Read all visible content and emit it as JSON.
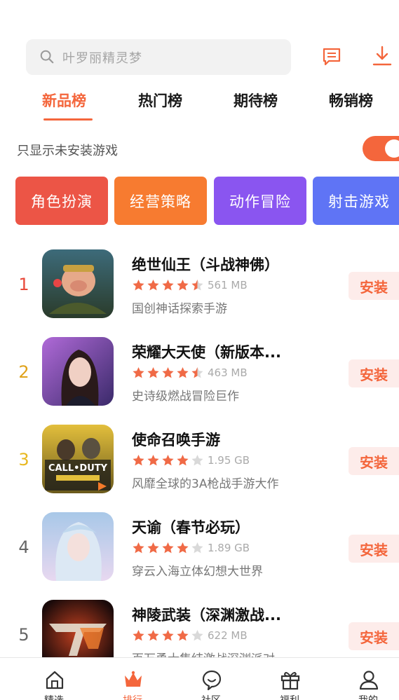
{
  "search": {
    "placeholder": "叶罗丽精灵梦"
  },
  "header_icons": [
    "message-icon",
    "download-icon"
  ],
  "tabs": [
    {
      "label": "新品榜",
      "active": true
    },
    {
      "label": "热门榜",
      "active": false
    },
    {
      "label": "期待榜",
      "active": false
    },
    {
      "label": "畅销榜",
      "active": false
    }
  ],
  "filter": {
    "label": "只显示未安装游戏",
    "toggle_on": true
  },
  "categories": [
    {
      "label": "角色扮演",
      "color": "#ec5546"
    },
    {
      "label": "经营策略",
      "color": "#f77b30"
    },
    {
      "label": "动作冒险",
      "color": "#8a55f0"
    },
    {
      "label": "射击游戏",
      "color": "#5f74f5"
    }
  ],
  "apps": [
    {
      "rank": "1",
      "rank_color": "#e8493a",
      "name": "绝世仙王（斗战神佛）",
      "rating": 4.5,
      "size": "561 MB",
      "desc": "国创神话探索手游",
      "install": "安装"
    },
    {
      "rank": "2",
      "rank_color": "#e0a21a",
      "name": "荣耀大天使（新版本...",
      "rating": 4.5,
      "size": "463 MB",
      "desc": "史诗级燃战冒险巨作",
      "install": "安装"
    },
    {
      "rank": "3",
      "rank_color": "#e8b820",
      "name": "使命召唤手游",
      "rating": 4,
      "size": "1.95 GB",
      "desc": "风靡全球的3A枪战手游大作",
      "install": "安装"
    },
    {
      "rank": "4",
      "rank_color": "#666666",
      "name": "天谕（春节必玩）",
      "rating": 4,
      "size": "1.89 GB",
      "desc": "穿云入海立体幻想大世界",
      "install": "安装"
    },
    {
      "rank": "5",
      "rank_color": "#666666",
      "name": "神陵武装（深渊激战...",
      "rating": 4,
      "size": "622 MB",
      "desc": "百万勇士集结激战深渊派对",
      "install": "安装"
    }
  ],
  "nav": [
    {
      "label": "精选",
      "icon": "home-icon",
      "active": false
    },
    {
      "label": "排行",
      "icon": "crown-icon",
      "active": true
    },
    {
      "label": "社区",
      "icon": "chat-bubble-icon",
      "active": false
    },
    {
      "label": "福利",
      "icon": "gift-icon",
      "active": false
    },
    {
      "label": "我的",
      "icon": "user-icon",
      "active": false
    }
  ],
  "colors": {
    "accent": "#f4663c",
    "star": "#f06a46",
    "star_empty": "#d9d9d9"
  }
}
